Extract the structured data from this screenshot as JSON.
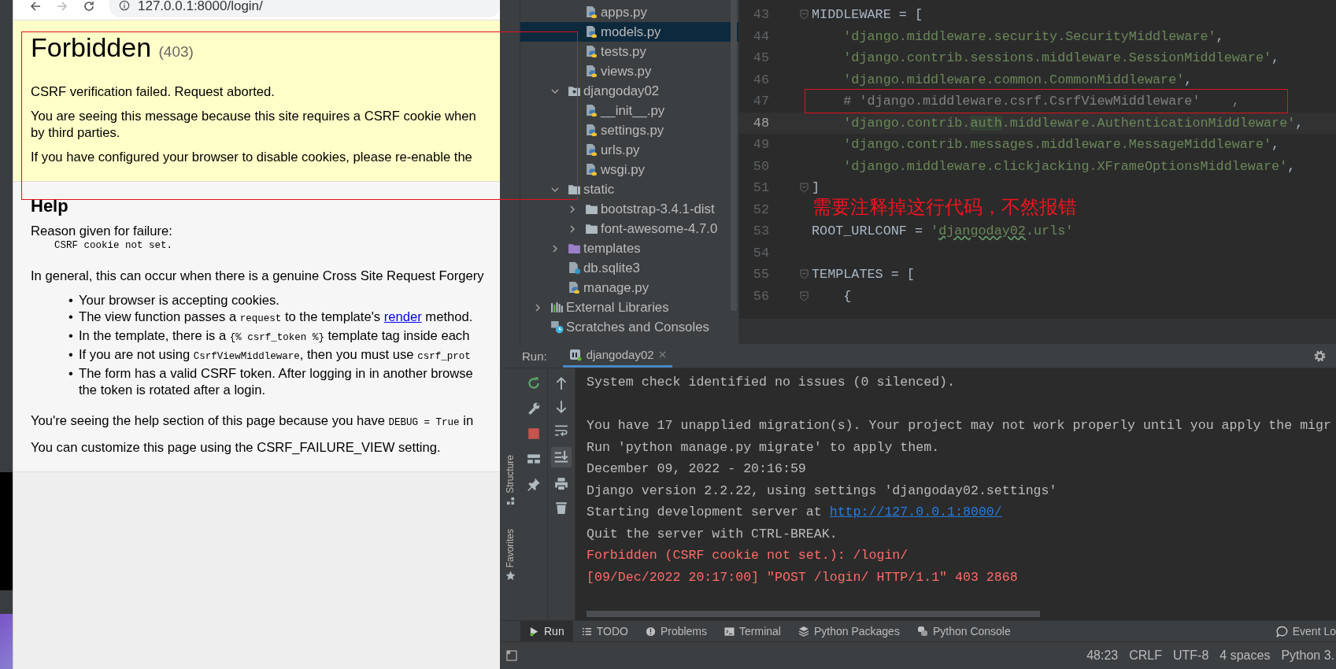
{
  "browser": {
    "url": "127.0.0.1:8000/login/",
    "error": {
      "title": "Forbidden",
      "code": "(403)",
      "lead": "CSRF verification failed. Request aborted.",
      "paragraphs": [
        {
          "lines": [
            "You are seeing this message because this site requires a CSRF cookie when",
            "by third parties."
          ]
        },
        {
          "lines": [
            "If you have configured your browser to disable cookies, please re-enable the"
          ]
        }
      ]
    },
    "help": {
      "heading": "Help",
      "reason_label": "Reason given for failure:",
      "reason": "CSRF cookie not set.",
      "intro": "In general, this can occur when there is a genuine Cross Site Request Forgery",
      "bullets": [
        {
          "marker": "•",
          "lines": [
            [
              {
                "kind": "text",
                "text": "Your browser is accepting cookies."
              }
            ]
          ]
        },
        {
          "marker": "•",
          "lines": [
            [
              {
                "kind": "text",
                "text": "The view function passes a "
              },
              {
                "kind": "code",
                "text": "request"
              },
              {
                "kind": "text",
                "text": " to the template's "
              },
              {
                "kind": "link",
                "text": "render"
              },
              {
                "kind": "text",
                "text": " method."
              }
            ]
          ]
        },
        {
          "marker": "•",
          "lines": [
            [
              {
                "kind": "text",
                "text": "In the template, there is a "
              },
              {
                "kind": "code",
                "text": "{% csrf_token %}"
              },
              {
                "kind": "text",
                "text": " template tag inside each"
              }
            ]
          ]
        },
        {
          "marker": "•",
          "lines": [
            [
              {
                "kind": "text",
                "text": "If you are not using "
              },
              {
                "kind": "code",
                "text": "CsrfViewMiddleware"
              },
              {
                "kind": "text",
                "text": ", then you must use "
              },
              {
                "kind": "code",
                "text": "csrf_prot"
              }
            ]
          ]
        },
        {
          "marker": "•",
          "lines": [
            [
              {
                "kind": "text",
                "text": "The form has a valid CSRF token. After logging in in another browse"
              }
            ],
            [
              {
                "kind": "text",
                "text": "the token is rotated after a login."
              }
            ]
          ]
        }
      ],
      "debug_note": [
        {
          "kind": "text",
          "text": "You're seeing the help section of this page because you have "
        },
        {
          "kind": "code",
          "text": "DEBUG = True"
        },
        {
          "kind": "text",
          "text": " in"
        }
      ],
      "customize": "You can customize this page using the CSRF_FAILURE_VIEW setting."
    }
  },
  "project_tree": {
    "items": [
      {
        "children": [
          {
            "children": [
              {
                "label": "apps.py",
                "kind": "python",
                "selected": false
              },
              {
                "label": "models.py",
                "kind": "python",
                "selected": true
              },
              {
                "label": "tests.py",
                "kind": "python",
                "selected": false
              },
              {
                "label": "views.py",
                "kind": "python",
                "selected": false
              }
            ]
          },
          {
            "label": "djangoday02",
            "kind": "package",
            "expanded": true,
            "selected": false,
            "children": [
              {
                "label": "__init__.py",
                "kind": "python",
                "selected": false
              },
              {
                "label": "settings.py",
                "kind": "python",
                "selected": false
              },
              {
                "label": "urls.py",
                "kind": "python",
                "selected": false
              },
              {
                "label": "wsgi.py",
                "kind": "python",
                "selected": false
              }
            ]
          },
          {
            "label": "static",
            "kind": "folder",
            "expanded": true,
            "selected": false,
            "children": [
              {
                "label": "bootstrap-3.4.1-dist",
                "kind": "folder",
                "expanded": false,
                "selected": false
              },
              {
                "label": "font-awesome-4.7.0",
                "kind": "folder",
                "expanded": false,
                "selected": false
              }
            ]
          },
          {
            "label": "templates",
            "kind": "template-folder",
            "expanded": false,
            "selected": false
          },
          {
            "label": "db.sqlite3",
            "kind": "unknown-file",
            "selected": false
          },
          {
            "label": "manage.py",
            "kind": "python",
            "selected": false
          }
        ]
      },
      {
        "label": "External Libraries",
        "kind": "libraries",
        "expanded": false,
        "selected": false
      },
      {
        "label": "Scratches and Consoles",
        "kind": "scratches",
        "selected": false
      }
    ]
  },
  "editor": {
    "lines": [
      {
        "number": "43",
        "current": false,
        "fold": true,
        "tokens": [
          {
            "kind": "plain",
            "text": "MIDDLEWARE = ["
          }
        ]
      },
      {
        "number": "44",
        "current": false,
        "fold": false,
        "tokens": [
          {
            "kind": "string",
            "text": "    'django.middleware.security.SecurityMiddleware'"
          },
          {
            "kind": "plain",
            "text": ","
          }
        ]
      },
      {
        "number": "45",
        "current": false,
        "fold": false,
        "tokens": [
          {
            "kind": "string",
            "text": "    'django.contrib.sessions.middleware.SessionMiddleware'"
          },
          {
            "kind": "plain",
            "text": ","
          }
        ]
      },
      {
        "number": "46",
        "current": false,
        "fold": false,
        "tokens": [
          {
            "kind": "string",
            "text": "    'django.middleware.common.CommonMiddleware'"
          },
          {
            "kind": "plain",
            "text": ","
          }
        ]
      },
      {
        "number": "47",
        "current": false,
        "fold": false,
        "boxed": true,
        "tokens": [
          {
            "kind": "comment",
            "text": "    # 'django.middleware.csrf.CsrfViewMiddleware'    ,"
          }
        ]
      },
      {
        "number": "48",
        "current": true,
        "fold": false,
        "tokens": [
          {
            "kind": "string",
            "text": "    'django.contrib."
          },
          {
            "kind": "match",
            "text": "auth"
          },
          {
            "kind": "string",
            "text": ".middleware.AuthenticationMiddleware'"
          },
          {
            "kind": "plain",
            "text": ","
          }
        ]
      },
      {
        "number": "49",
        "current": false,
        "fold": false,
        "tokens": [
          {
            "kind": "string",
            "text": "    'django.contrib.messages.middleware.MessageMiddleware'"
          },
          {
            "kind": "plain",
            "text": ","
          }
        ]
      },
      {
        "number": "50",
        "current": false,
        "fold": false,
        "tokens": [
          {
            "kind": "string",
            "text": "    'django.middleware.clickjacking.XFrameOptionsMiddleware'"
          },
          {
            "kind": "plain",
            "text": ","
          }
        ]
      },
      {
        "number": "51",
        "current": false,
        "fold": true,
        "tokens": [
          {
            "kind": "plain",
            "text": "]"
          }
        ]
      },
      {
        "number": "52",
        "current": false,
        "fold": false
      },
      {
        "number": "53",
        "current": false,
        "fold": false,
        "tokens": [
          {
            "kind": "plain",
            "text": "ROOT_URLCONF = "
          },
          {
            "kind": "string",
            "text": "'"
          },
          {
            "kind": "typo",
            "text": "djangoday02"
          },
          {
            "kind": "string",
            "text": ".urls'"
          }
        ]
      },
      {
        "number": "54",
        "current": false,
        "fold": false
      },
      {
        "number": "55",
        "current": false,
        "fold": true,
        "tokens": [
          {
            "kind": "plain",
            "text": "TEMPLATES = ["
          }
        ]
      },
      {
        "number": "56",
        "current": false,
        "fold": true,
        "tokens": [
          {
            "kind": "plain",
            "text": "    {"
          }
        ]
      }
    ]
  },
  "annotation": {
    "text": "需要注释掉这行代码，不然报错"
  },
  "run_panel": {
    "label": "Run:",
    "tabs": [
      {
        "label": "djangoday02",
        "selected": true
      }
    ],
    "console": [
      {
        "kind": "normal",
        "gap_before": false,
        "text": "System check identified no issues (0 silenced)."
      },
      {
        "kind": "normal",
        "gap_before": true,
        "text": "You have 17 unapplied migration(s). Your project may not work properly until you apply the migr"
      },
      {
        "kind": "normal",
        "gap_before": false,
        "text": "Run 'python manage.py migrate' to apply them."
      },
      {
        "kind": "normal",
        "gap_before": false,
        "text": "December 09, 2022 - 20:16:59"
      },
      {
        "kind": "normal",
        "gap_before": false,
        "text": "Django version 2.2.22, using settings 'djangoday02.settings'"
      },
      {
        "kind": "normal",
        "gap_before": false,
        "text": "Starting development server at ",
        "link": "http://127.0.0.1:8000/"
      },
      {
        "kind": "normal",
        "gap_before": false,
        "text": "Quit the server with CTRL-BREAK."
      },
      {
        "kind": "error",
        "gap_before": false,
        "text": "Forbidden (CSRF cookie not set.): /login/"
      },
      {
        "kind": "error",
        "gap_before": false,
        "text": "[09/Dec/2022 20:17:00] \"POST /login/ HTTP/1.1\" 403 2868"
      }
    ]
  },
  "side_labels": [
    "Structure",
    "Favorites"
  ],
  "tool_tabs": [
    {
      "label": "Run",
      "kind": "run",
      "selected": true
    },
    {
      "label": "TODO",
      "kind": "todo",
      "selected": false
    },
    {
      "label": "Problems",
      "kind": "problems",
      "selected": false
    },
    {
      "label": "Terminal",
      "kind": "terminal",
      "selected": false
    },
    {
      "label": "Python Packages",
      "kind": "packages",
      "selected": false
    },
    {
      "label": "Python Console",
      "kind": "console",
      "selected": false
    }
  ],
  "event_log": "Event Lo",
  "status_bar": [
    "48:23",
    "CRLF",
    "UTF-8",
    "4 spaces",
    "Python 3."
  ]
}
